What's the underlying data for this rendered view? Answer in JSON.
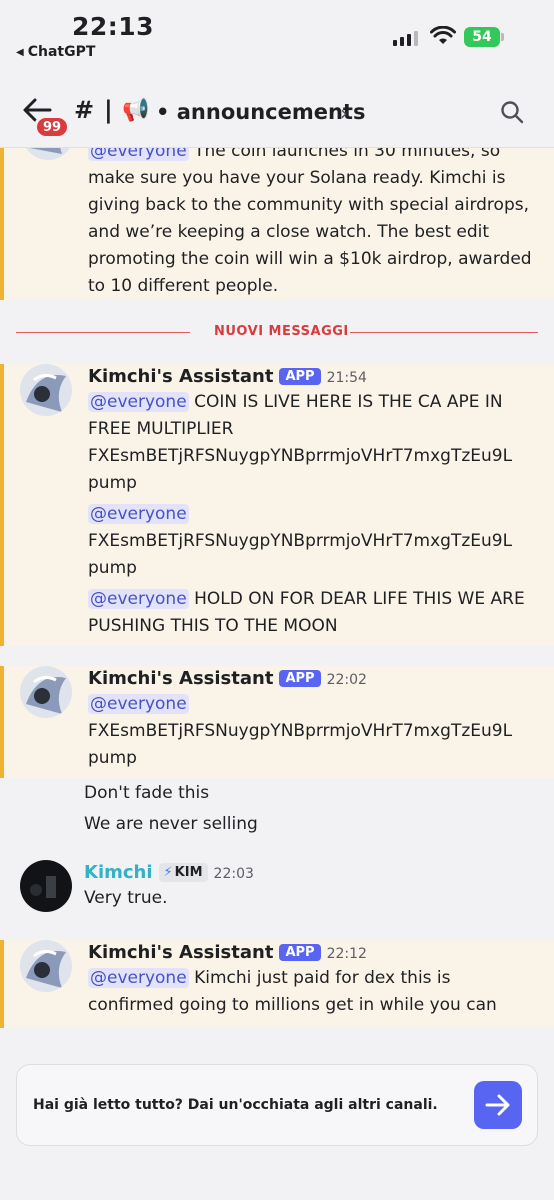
{
  "status_bar": {
    "time": "22:13",
    "back_app": "ChatGPT",
    "battery": "54"
  },
  "header": {
    "unread_count": "99",
    "hash": "#",
    "separator": "|",
    "bullet": "•",
    "channel_name": "announcements",
    "chevron": "›"
  },
  "messages": {
    "first": {
      "mention": "@everyone",
      "text": " The coin launches in 30 minutes, so make sure you have your Solana ready. Kimchi is giving back to the community with special airdrops, and we’re keeping a close watch. The best edit promoting the coin will win a $10k airdrop, awarded to 10 different people."
    },
    "divider": "NUOVI MESSAGGI",
    "m1": {
      "author": "Kimchi's Assistant",
      "tag": "APP",
      "time": "21:54",
      "lines": [
        {
          "mention": "@everyone",
          "text": " COIN IS LIVE HERE IS THE CA APE IN FREE MULTIPLIER FXEsmBETjRFSNuygpYNBprrmjoVHrT7mxgTzEu9L pump"
        },
        {
          "mention": "@everyone",
          "text": " FXEsmBETjRFSNuygpYNBprrmjoVHrT7mxgTzEu9L pump"
        },
        {
          "mention": "@everyone",
          "text": " HOLD ON FOR DEAR LIFE THIS WE ARE PUSHING THIS TO THE MOON"
        }
      ]
    },
    "m2": {
      "author": "Kimchi's Assistant",
      "tag": "APP",
      "time": "22:02",
      "mention": "@everyone",
      "text": " FXEsmBETjRFSNuygpYNBprrmjoVHrT7mxgTzEu9L pump",
      "follow1": "Don't fade this",
      "follow2": "We are never selling"
    },
    "m3": {
      "author": "Kimchi",
      "tag": "KIM",
      "time": "22:03",
      "text": "Very true."
    },
    "m4": {
      "author": "Kimchi's Assistant",
      "tag": "APP",
      "time": "22:12",
      "mention": "@everyone",
      "text": " Kimchi just paid for dex this is confirmed going to millions get in while you can"
    }
  },
  "footer": {
    "prompt": "Hai già letto tutto? Dai un'occhiata agli altri canali."
  },
  "colors": {
    "accent": "#5865f2",
    "mention_bg": "#faf3e7",
    "mention_bar": "#f0b232",
    "badge": "#d83c3e",
    "kimchi_name": "#33b1c6"
  }
}
